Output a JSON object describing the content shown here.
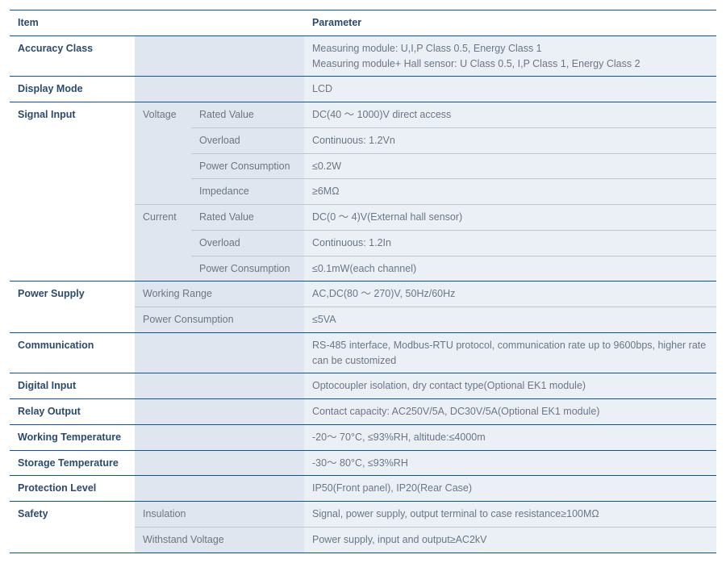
{
  "headers": {
    "item": "Item",
    "parameter": "Parameter"
  },
  "rows": {
    "accuracy_class": {
      "label": "Accuracy Class",
      "value": "Measuring module: U,I,P Class 0.5, Energy Class 1\nMeasuring module+ Hall sensor: U Class 0.5, I,P Class 1, Energy Class 2"
    },
    "display_mode": {
      "label": "Display Mode",
      "value": "LCD"
    },
    "signal_input": {
      "label": "Signal Input",
      "voltage": {
        "label": "Voltage",
        "rated_value": {
          "label": "Rated Value",
          "value": "DC(40 ～ 1000)V direct access"
        },
        "overload": {
          "label": "Overload",
          "value": "Continuous: 1.2Vn"
        },
        "power_consumption": {
          "label": "Power Consumption",
          "value": "≤0.2W"
        },
        "impedance": {
          "label": "Impedance",
          "value": "≥6MΩ"
        }
      },
      "current": {
        "label": "Current",
        "rated_value": {
          "label": "Rated Value",
          "value": "DC(0 ～ 4)V(External hall sensor)"
        },
        "overload": {
          "label": "Overload",
          "value": "Continuous: 1.2In"
        },
        "power_consumption": {
          "label": "Power Consumption",
          "value": "≤0.1mW(each channel)"
        }
      }
    },
    "power_supply": {
      "label": "Power Supply",
      "working_range": {
        "label": "Working Range",
        "value": "AC,DC(80 ～ 270)V, 50Hz/60Hz"
      },
      "power_consumption": {
        "label": "Power Consumption",
        "value": "≤5VA"
      }
    },
    "communication": {
      "label": "Communication",
      "value": "RS-485 interface, Modbus-RTU protocol, communication rate up to 9600bps, higher rate can be customized"
    },
    "digital_input": {
      "label": "Digital Input",
      "value": "Optocoupler isolation, dry contact type(Optional EK1 module)"
    },
    "relay_output": {
      "label": "Relay Output",
      "value": "Contact capacity: AC250V/5A, DC30V/5A(Optional EK1 module)"
    },
    "working_temperature": {
      "label": "Working Temperature",
      "value": "-20～ 70°C, ≤93%RH, altitude:≤4000m"
    },
    "storage_temperature": {
      "label": "Storage Temperature",
      "value": "-30～ 80°C, ≤93%RH"
    },
    "protection_level": {
      "label": "Protection Level",
      "value": "IP50(Front panel), IP20(Rear Case)"
    },
    "safety": {
      "label": "Safety",
      "insulation": {
        "label": "Insulation",
        "value": "Signal, power supply, output terminal to case resistance≥100MΩ"
      },
      "withstand_voltage": {
        "label": "Withstand Voltage",
        "value": "Power supply, input and output≥AC2kV"
      }
    }
  }
}
